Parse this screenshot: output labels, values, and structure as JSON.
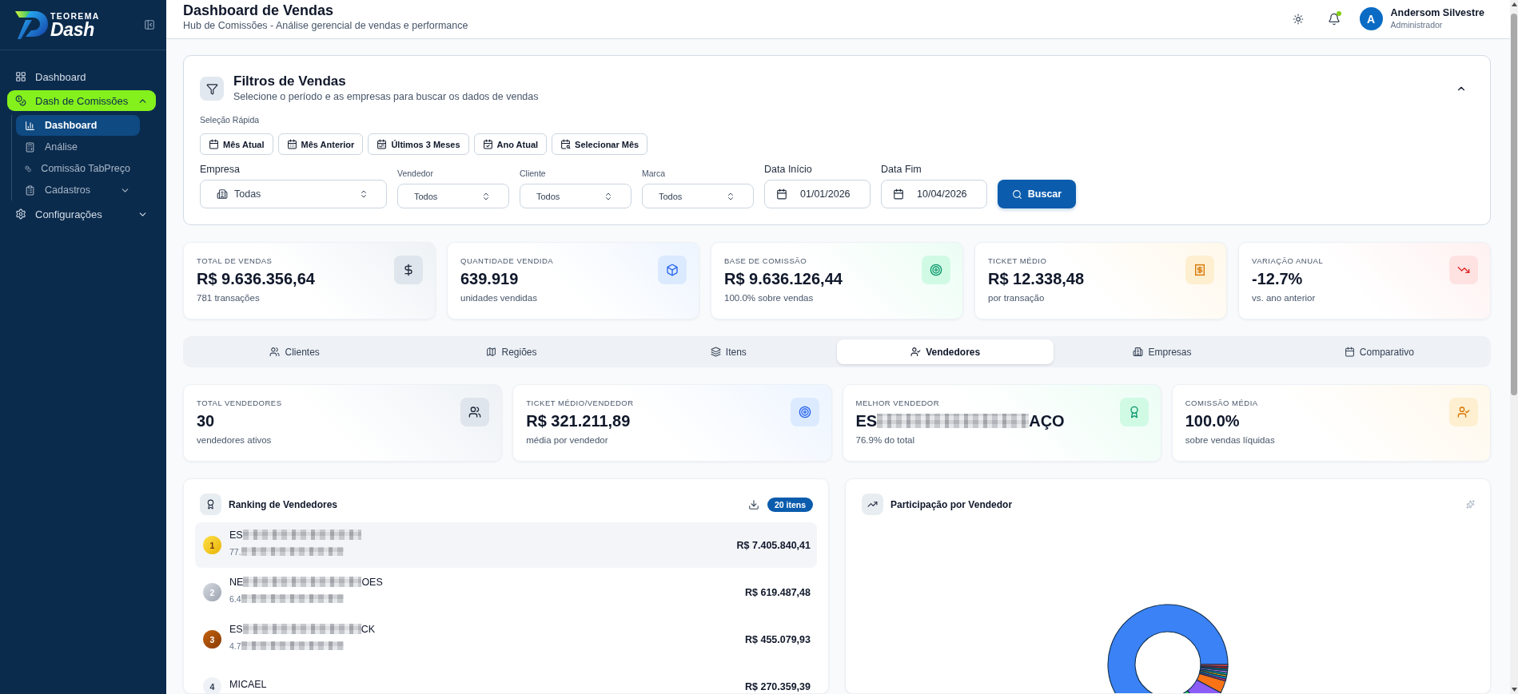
{
  "sidebar": {
    "brand": {
      "top": "TEOREMA",
      "name": "Dash"
    },
    "items": [
      {
        "label": "Dashboard",
        "selected": false
      },
      {
        "label": "Dash de Comissões",
        "selected": true,
        "expanded": true,
        "children": [
          {
            "label": "Dashboard",
            "selected": true
          },
          {
            "label": "Análise",
            "selected": false
          },
          {
            "label": "Comissão TabPreço",
            "selected": false
          },
          {
            "label": "Cadastros",
            "selected": false,
            "expanded": false
          }
        ]
      },
      {
        "label": "Configurações",
        "selected": false,
        "expanded": false
      }
    ]
  },
  "header": {
    "title": "Dashboard de Vendas",
    "subtitle": "Hub de Comissões - Análise gerencial de vendas e performance",
    "notifications_unread": true,
    "user": {
      "initial": "A",
      "name": "Andersom Silvestre",
      "role": "Administrador"
    }
  },
  "filters": {
    "title": "Filtros de Vendas",
    "subtitle": "Selecione o período e as empresas para buscar os dados de vendas",
    "expanded": true,
    "quick_label": "Seleção Rápida",
    "quick_buttons": [
      "Mês Atual",
      "Mês Anterior",
      "Últimos 3 Meses",
      "Ano Atual",
      "Selecionar Mês"
    ],
    "fields": [
      {
        "kind": "company",
        "label": "Empresa",
        "value": "Todas"
      },
      {
        "kind": "select",
        "label": "Vendedor",
        "value": "Todos"
      },
      {
        "kind": "select",
        "label": "Cliente",
        "value": "Todos"
      },
      {
        "kind": "select",
        "label": "Marca",
        "value": "Todos"
      },
      {
        "kind": "date",
        "label": "Data Início",
        "value": "01/01/2026"
      },
      {
        "kind": "date",
        "label": "Data Fim",
        "value": "10/04/2026"
      }
    ],
    "search_button": "Buscar"
  },
  "kpis": [
    {
      "label": "TOTAL DE VENDAS",
      "value": "R$ 9.636.356,64",
      "note": "781 transações"
    },
    {
      "label": "QUANTIDADE VENDIDA",
      "value": "639.919",
      "note": "unidades vendidas"
    },
    {
      "label": "BASE DE COMISSÃO",
      "value": "R$ 9.636.126,44",
      "note": "100.0% sobre vendas"
    },
    {
      "label": "TICKET MÉDIO",
      "value": "R$ 12.338,48",
      "note": "por transação"
    },
    {
      "label": "VARIAÇÃO ANUAL",
      "value": "-12.7%",
      "note": "vs. ano anterior"
    }
  ],
  "tabs": [
    {
      "label": "Clientes",
      "selected": false
    },
    {
      "label": "Regiões",
      "selected": false
    },
    {
      "label": "Itens",
      "selected": false
    },
    {
      "label": "Vendedores",
      "selected": true
    },
    {
      "label": "Empresas",
      "selected": false
    },
    {
      "label": "Comparativo",
      "selected": false
    }
  ],
  "seller_stats": [
    {
      "label": "TOTAL VENDEDORES",
      "value": "30",
      "note": "vendedores ativos"
    },
    {
      "label": "TICKET MÉDIO/VENDEDOR",
      "value": "R$ 321.211,89",
      "note": "média por vendedor"
    },
    {
      "label": "MELHOR VENDEDOR",
      "value": [
        {
          "kind": "text",
          "text": "ES"
        },
        {
          "kind": "redacted"
        },
        {
          "kind": "text",
          "text": "AÇO"
        }
      ],
      "note": "76.9% do total"
    },
    {
      "label": "COMISSÃO MÉDIA",
      "value": "100.0%",
      "note": "sobre vendas líquidas"
    }
  ],
  "ranking": {
    "title": "Ranking de Vendedores",
    "count": "20 itens",
    "rows": [
      {
        "rank": "1",
        "name": [
          {
            "kind": "text",
            "text": "ES"
          },
          {
            "kind": "redacted"
          }
        ],
        "detail": [
          {
            "kind": "text",
            "text": "77."
          },
          {
            "kind": "redacted"
          }
        ],
        "amount": "R$ 7.405.840,41",
        "highlighted": true
      },
      {
        "rank": "2",
        "name": [
          {
            "kind": "text",
            "text": "NE"
          },
          {
            "kind": "redacted"
          },
          {
            "kind": "text",
            "text": "OES"
          }
        ],
        "detail": [
          {
            "kind": "text",
            "text": "6.4"
          },
          {
            "kind": "redacted"
          }
        ],
        "amount": "R$ 619.487,48",
        "highlighted": false
      },
      {
        "rank": "3",
        "name": [
          {
            "kind": "text",
            "text": "ES"
          },
          {
            "kind": "redacted"
          },
          {
            "kind": "text",
            "text": "CK"
          }
        ],
        "detail": [
          {
            "kind": "text",
            "text": "4.7"
          },
          {
            "kind": "redacted"
          }
        ],
        "amount": "R$ 455.079,93",
        "highlighted": false
      },
      {
        "rank": "4",
        "name": [
          {
            "kind": "text",
            "text": "MICAEL"
          }
        ],
        "amount": "R$ 270.359,39",
        "highlighted": false
      }
    ]
  },
  "share_panel": {
    "title": "Participação por Vendedor"
  }
}
